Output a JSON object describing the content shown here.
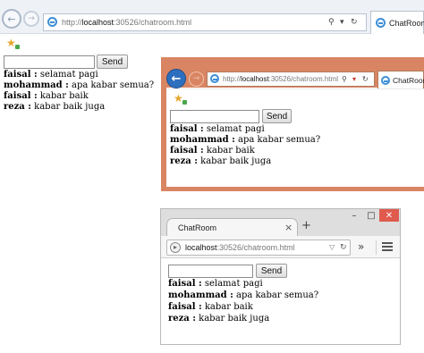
{
  "w1": {
    "url_prefix": "http://",
    "url_host": "localhost",
    "url_rest": ":30526/chatroom.html",
    "search_icon": "⚲",
    "dropdown_icon": "▾",
    "refresh_icon": "↻",
    "tab_title": "ChatRoom",
    "send_label": "Send",
    "messages": [
      {
        "name": "faisal :",
        "text": " selamat pagi"
      },
      {
        "name": "mohammad :",
        "text": " apa kabar semua?"
      },
      {
        "name": "faisal :",
        "text": " kabar baik"
      },
      {
        "name": "reza :",
        "text": " kabar baik juga"
      }
    ]
  },
  "w2": {
    "url_prefix": "http://",
    "url_host": "localhost",
    "url_rest": ":30526/chatroom.html",
    "tab_title": "ChatRoom",
    "send_label": "Send",
    "messages": [
      {
        "name": "faisal :",
        "text": " selamat pagi"
      },
      {
        "name": "mohammad :",
        "text": " apa kabar semua?"
      },
      {
        "name": "faisal :",
        "text": " kabar baik"
      },
      {
        "name": "reza :",
        "text": " kabar baik juga"
      }
    ]
  },
  "w3": {
    "tab_title": "ChatRoom",
    "tab_close": "×",
    "new_tab": "+",
    "url_host": "localhost",
    "url_rest": ":30526/chatroom.html",
    "overflow_icon": "»",
    "send_label": "Send",
    "win_min": "–",
    "win_max": "□",
    "win_close": "✕",
    "messages": [
      {
        "name": "faisal :",
        "text": " selamat pagi"
      },
      {
        "name": "mohammad :",
        "text": " apa kabar semua?"
      },
      {
        "name": "faisal :",
        "text": " kabar baik"
      },
      {
        "name": "reza :",
        "text": " kabar baik juga"
      }
    ]
  },
  "colors": {
    "ie_frame": "#eef2f7",
    "w2_frame": "#d98563",
    "w2_back": "#2d6fbf",
    "ff_close": "#e05a4e"
  }
}
